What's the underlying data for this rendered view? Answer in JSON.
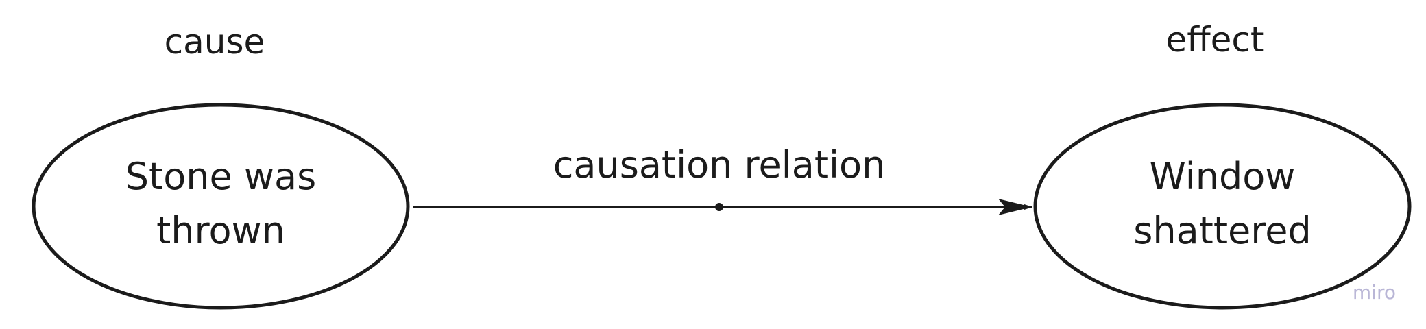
{
  "diagram": {
    "headers": {
      "left": "cause",
      "right": "effect"
    },
    "nodes": {
      "cause": {
        "line1": "Stone was",
        "line2": "thrown"
      },
      "effect": {
        "line1": "Window",
        "line2": "shattered"
      }
    },
    "edge": {
      "label": "causation relation"
    },
    "watermark": "miro",
    "colors": {
      "stroke": "#1b1b1b",
      "watermark": "#b9b6d6",
      "background": "#ffffff"
    }
  }
}
